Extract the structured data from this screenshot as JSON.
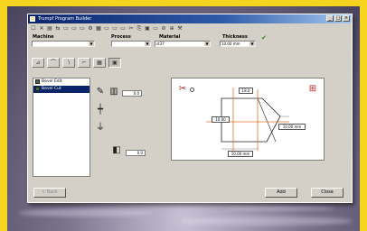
{
  "window": {
    "title": "Trumpf Program Builder",
    "controls": [
      "_",
      "□",
      "×"
    ]
  },
  "toolbar": {
    "icons": [
      "☐",
      "✕",
      "▤",
      "⇆",
      "▭",
      "▭",
      "▭",
      "⚙",
      "▦",
      "▭",
      "▭",
      "▭",
      "✂",
      "⎘",
      "▣",
      "▭",
      "⊘",
      "⊕",
      "⚒"
    ]
  },
  "params": {
    "machine": {
      "label": "Machine"
    },
    "process": {
      "label": "Process"
    },
    "material": {
      "label": "Material",
      "value": "st37"
    },
    "thickness": {
      "label": "Thickness",
      "value": "10.00 mm"
    },
    "status": "✔"
  },
  "tree": {
    "items": [
      {
        "label": "Bevel Edit"
      },
      {
        "label": "Bevel Cut"
      }
    ]
  },
  "fields": {
    "f1": "0.0",
    "f2": "0.0"
  },
  "canvas": {
    "dims": {
      "d1": "18.0",
      "d2": "10.00",
      "d3": "10.00 mm",
      "d4": "10.00 mm"
    }
  },
  "buttons": {
    "back": "< Back",
    "add": "Add",
    "close": "Close"
  }
}
